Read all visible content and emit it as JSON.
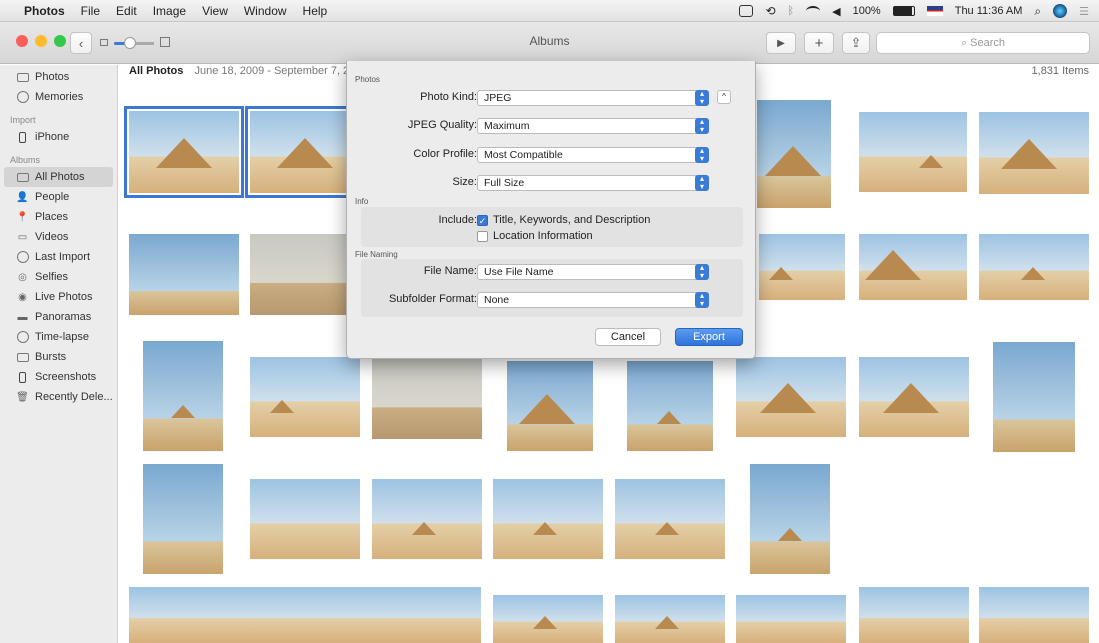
{
  "menubar": {
    "apple": "",
    "items": [
      "Photos",
      "File",
      "Edit",
      "Image",
      "View",
      "Window",
      "Help"
    ],
    "battery": "100%",
    "clock": "Thu 11:36 AM"
  },
  "toolbar": {
    "title": "Albums",
    "play": "▶",
    "add": "+",
    "share": "⇪",
    "search_placeholder": "Search",
    "back": "‹"
  },
  "sidebar": {
    "sections": [
      {
        "header": "",
        "items": [
          {
            "label": "Photos",
            "icon": "photos-icon"
          },
          {
            "label": "Memories",
            "icon": "memories-icon"
          }
        ]
      },
      {
        "header": "Import",
        "items": [
          {
            "label": "iPhone",
            "icon": "iphone-icon"
          }
        ]
      },
      {
        "header": "Albums",
        "items": [
          {
            "label": "All Photos",
            "icon": "all-photos-icon"
          },
          {
            "label": "People",
            "icon": "people-icon"
          },
          {
            "label": "Places",
            "icon": "places-icon"
          },
          {
            "label": "Videos",
            "icon": "videos-icon"
          },
          {
            "label": "Last Import",
            "icon": "last-import-icon"
          },
          {
            "label": "Selfies",
            "icon": "selfies-icon"
          },
          {
            "label": "Live Photos",
            "icon": "live-photos-icon"
          },
          {
            "label": "Panoramas",
            "icon": "panoramas-icon"
          },
          {
            "label": "Time-lapse",
            "icon": "time-lapse-icon"
          },
          {
            "label": "Bursts",
            "icon": "bursts-icon"
          },
          {
            "label": "Screenshots",
            "icon": "screenshots-icon"
          },
          {
            "label": "Recently Dele...",
            "icon": "trash-icon"
          }
        ]
      }
    ],
    "selected": "All Photos"
  },
  "main": {
    "title": "All Photos",
    "date_range": "June 18, 2009 - September 7, 2017",
    "count": "1,831 Items"
  },
  "dialog": {
    "section_photos": "Photos",
    "photo_kind_label": "Photo Kind:",
    "photo_kind_value": "JPEG",
    "jpeg_quality_label": "JPEG Quality:",
    "jpeg_quality_value": "Maximum",
    "color_profile_label": "Color Profile:",
    "color_profile_value": "Most Compatible",
    "size_label": "Size:",
    "size_value": "Full Size",
    "section_info": "Info",
    "include_label": "Include:",
    "include_title_keywords": "Title, Keywords, and Description",
    "include_title_checked": true,
    "include_location": "Location Information",
    "include_location_checked": false,
    "section_naming": "File Naming",
    "file_name_label": "File Name:",
    "file_name_value": "Use File Name",
    "subfolder_label": "Subfolder Format:",
    "subfolder_value": "None",
    "cancel": "Cancel",
    "export": "Export"
  },
  "colors": {
    "accent": "#3a7bd5",
    "red": "#fc5f57",
    "yellow": "#fdbc2e",
    "green": "#34c84a"
  }
}
